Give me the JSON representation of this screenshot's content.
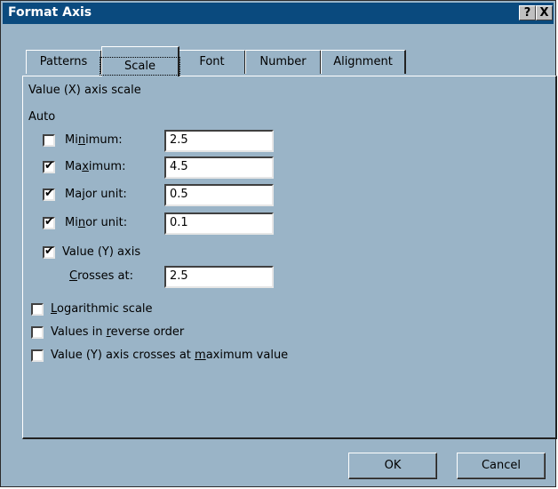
{
  "window": {
    "title": "Format Axis",
    "help_label": "?",
    "close_label": "X"
  },
  "tabs": [
    {
      "label": "Patterns"
    },
    {
      "label": "Scale"
    },
    {
      "label": "Font"
    },
    {
      "label": "Number"
    },
    {
      "label": "Alignment"
    }
  ],
  "active_tab": "Scale",
  "section": {
    "heading": "Value (X) axis scale",
    "auto_label": "Auto"
  },
  "fields": {
    "minimum": {
      "label_pre": "Mi",
      "label_u": "n",
      "label_post": "imum:",
      "checked": false,
      "value": "2.5"
    },
    "maximum": {
      "label_pre": "Ma",
      "label_u": "x",
      "label_post": "imum:",
      "checked": true,
      "value": "4.5"
    },
    "major_unit": {
      "label_pre": "Ma",
      "label_u": "j",
      "label_post": "or unit:",
      "checked": true,
      "value": "0.5"
    },
    "minor_unit": {
      "label_pre": "Mi",
      "label_u": "n",
      "label_post": "or unit:",
      "checked": true,
      "value": "0.1"
    },
    "crosses_axis": {
      "label": "Value (Y) axis",
      "checked": true
    },
    "crosses_at": {
      "label_u": "C",
      "label_post": "rosses at:",
      "value": "2.5"
    }
  },
  "options": {
    "logarithmic": {
      "label_u": "L",
      "label_post": "ogarithmic scale",
      "checked": false
    },
    "reverse": {
      "label_pre": "Values in ",
      "label_u": "r",
      "label_post": "everse order",
      "checked": false
    },
    "max_cross": {
      "label_pre": "Value (Y) axis crosses at ",
      "label_u": "m",
      "label_post": "aximum value",
      "checked": false
    }
  },
  "buttons": {
    "ok": "OK",
    "cancel": "Cancel"
  },
  "check_glyph": "✔"
}
